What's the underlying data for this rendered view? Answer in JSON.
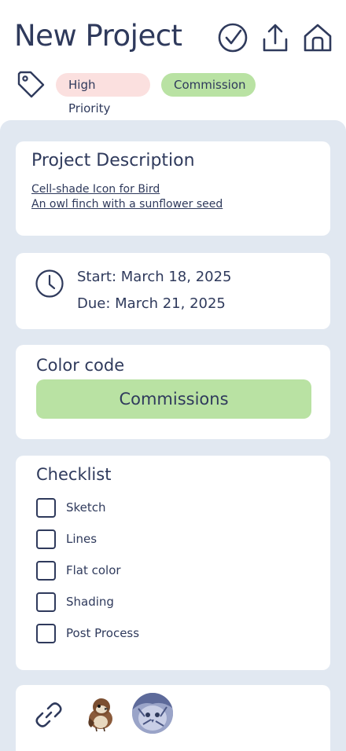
{
  "header": {
    "title": "New Project"
  },
  "tags": {
    "priority": "High Priority",
    "category": "Commission"
  },
  "description": {
    "heading": "Project Description",
    "line1": "Cell-shade Icon for Bird",
    "line2": "An owl finch with a sunflower seed"
  },
  "dates": {
    "start": "Start: March 18, 2025",
    "due": "Due: March 21, 2025"
  },
  "color_code": {
    "heading": "Color code",
    "value": "Commissions",
    "color": "#b9e2a3"
  },
  "checklist": {
    "heading": "Checklist",
    "items": [
      {
        "label": "Sketch",
        "checked": false
      },
      {
        "label": "Lines",
        "checked": false
      },
      {
        "label": "Flat color",
        "checked": false
      },
      {
        "label": "Shading",
        "checked": false
      },
      {
        "label": "Post Process",
        "checked": false
      }
    ]
  },
  "colors": {
    "text": "#2f3a5c",
    "panel": "#e1e8f1",
    "priority_chip": "#fbe0df",
    "commission_chip": "#b9e2a3"
  },
  "icons": [
    "check-circle-icon",
    "share-icon",
    "home-icon",
    "tag-icon",
    "clock-icon",
    "link-icon"
  ]
}
